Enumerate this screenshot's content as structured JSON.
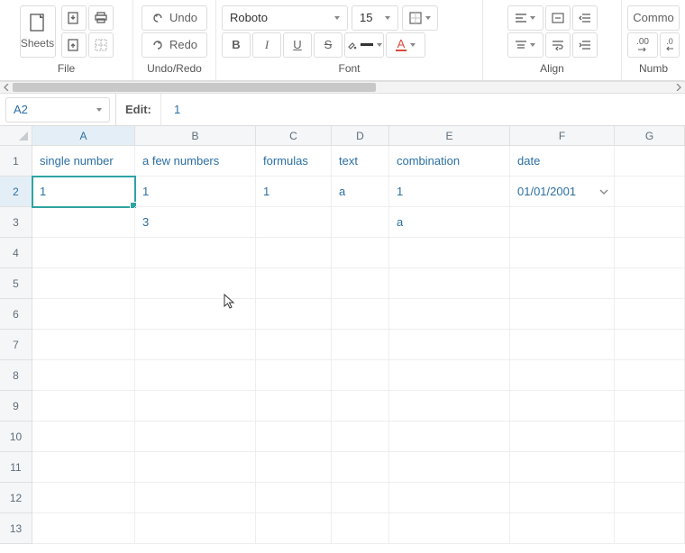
{
  "toolbar": {
    "sheets_label": "Sheets",
    "undo": "Undo",
    "redo": "Redo",
    "font_name": "Roboto",
    "font_size": "15",
    "bold": "B",
    "italic": "I",
    "underline": "U",
    "strike": "S",
    "common_label": "Commo",
    "number_format": ".00",
    "section_file": "File",
    "section_undoredo": "Undo/Redo",
    "section_font": "Font",
    "section_align": "Align",
    "section_number": "Numb"
  },
  "formula_bar": {
    "cell_ref": "A2",
    "edit_label": "Edit:",
    "value": "1"
  },
  "columns": [
    "A",
    "B",
    "C",
    "D",
    "E",
    "F",
    "G"
  ],
  "column_widths": [
    "colA",
    "colB",
    "colC",
    "colD",
    "colE",
    "colF",
    "colG"
  ],
  "rows": [
    "1",
    "2",
    "3",
    "4",
    "5",
    "6",
    "7",
    "8",
    "9",
    "10",
    "11",
    "12",
    "13"
  ],
  "selected_cell": "A2",
  "cells": {
    "A1": "single number",
    "B1": "a few numbers",
    "C1": "formulas",
    "D1": "text",
    "E1": "combination",
    "F1": "date",
    "A2": "1",
    "B2": "1",
    "C2": "1",
    "D2": "a",
    "E2": "1",
    "F2": "01/01/2001",
    "B3": "3",
    "E3": "a"
  }
}
